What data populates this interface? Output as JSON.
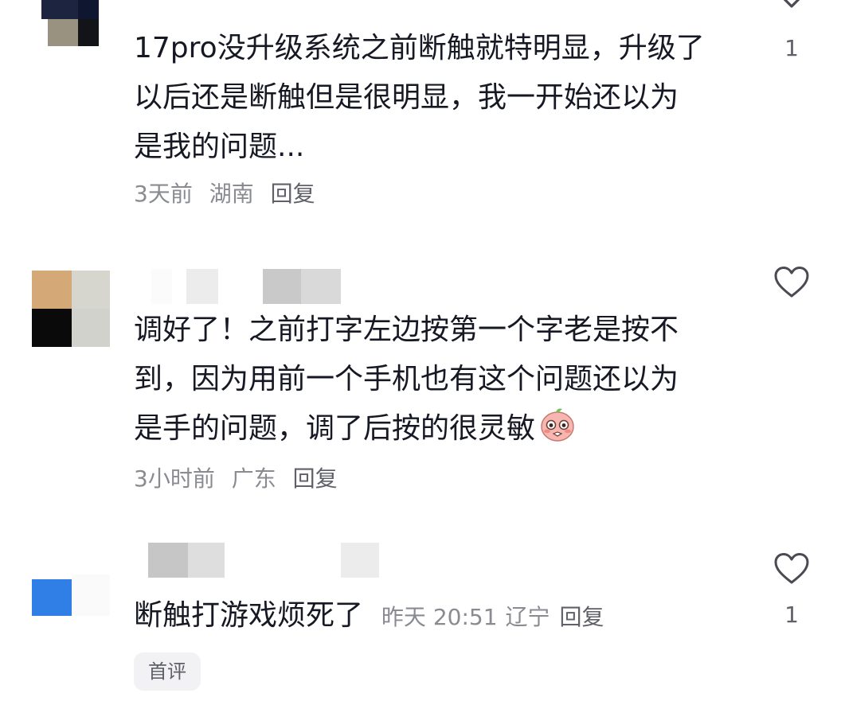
{
  "comments": [
    {
      "text_lines": [
        "17pro没升级系统之前断触就特明显，升级了",
        "以后还是断触但是很明显，我一开始还以为",
        "是我的问题..."
      ],
      "time": "3天前",
      "location": "湖南",
      "reply_label": "回复",
      "like_count": "1"
    },
    {
      "text_lines": [
        "调好了！之前打字左边按第一个字老是按不",
        "到，因为用前一个手机也有这个问题还以为",
        "是手的问题，调了后按的很灵敏"
      ],
      "emoji_icon": "blushing-face-emoji",
      "time": "3小时前",
      "location": "广东",
      "reply_label": "回复",
      "like_count": ""
    },
    {
      "text_lines": [
        "断触打游戏烦死了"
      ],
      "time": "昨天 20:51",
      "location": "辽宁",
      "reply_label": "回复",
      "like_count": "1",
      "badge": "首评"
    }
  ],
  "icons": {
    "like": "heart-outline-icon"
  },
  "colors": {
    "text": "#161823",
    "meta": "#8a8b91",
    "icon": "#4a4b52"
  }
}
